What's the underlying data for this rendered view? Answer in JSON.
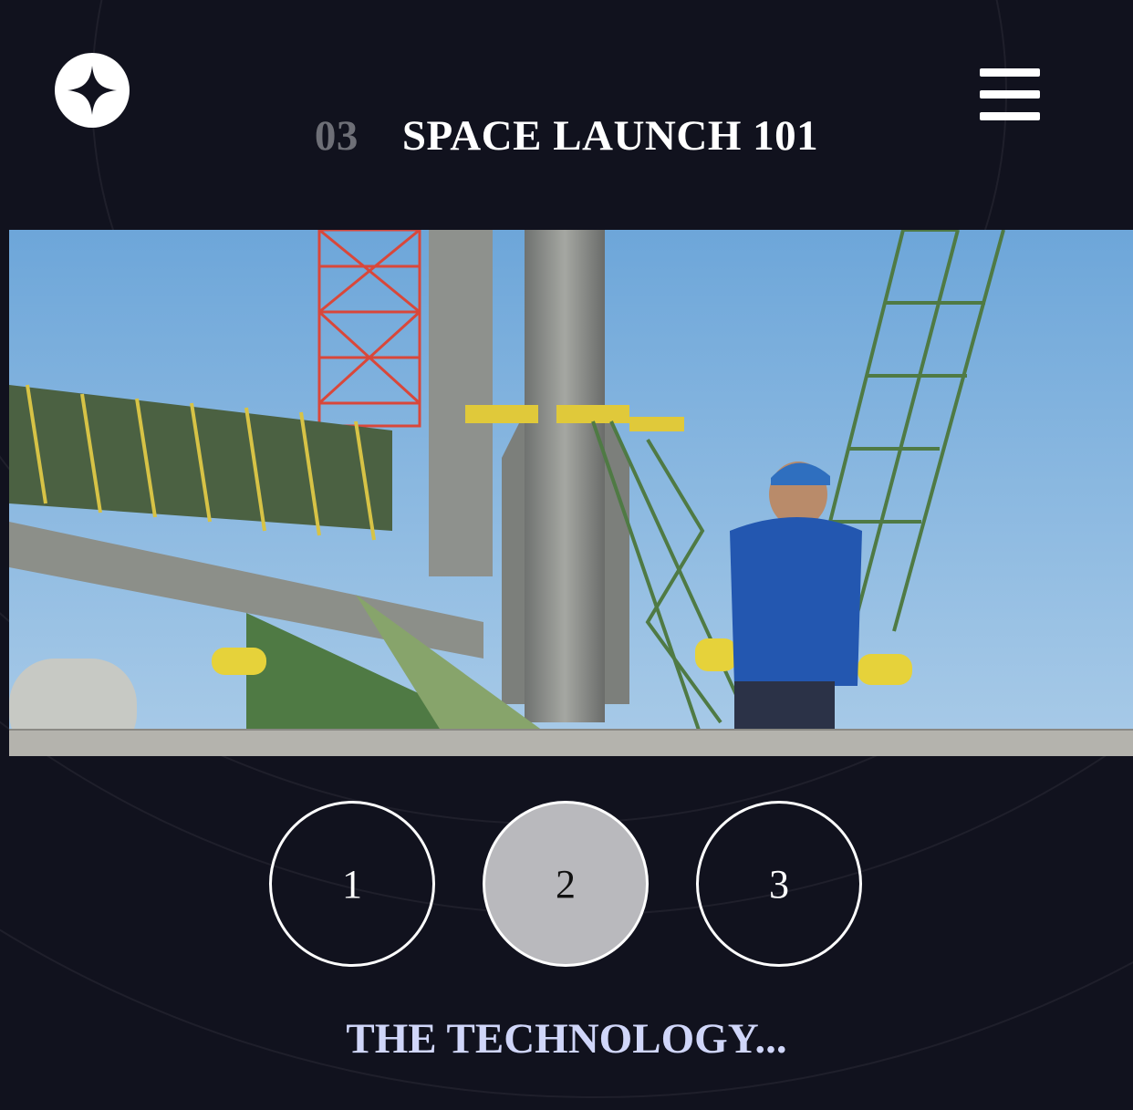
{
  "header": {
    "logo_icon": "star-logo-icon",
    "menu_icon": "hamburger-menu-icon",
    "page_number": "03",
    "page_title": "SPACE LAUNCH 101"
  },
  "image": {
    "subject": "launch-vehicle-photo"
  },
  "steps": {
    "items": [
      "1",
      "2",
      "3"
    ],
    "active_index": 1
  },
  "section": {
    "terminology_label": "THE TECHNOLOGY..."
  },
  "colors": {
    "background": "#11121e",
    "title_number": "#6e6f77",
    "title_text": "#ffffff",
    "subtitle": "#d0d6f9",
    "active_step": "#b9b9bd"
  }
}
